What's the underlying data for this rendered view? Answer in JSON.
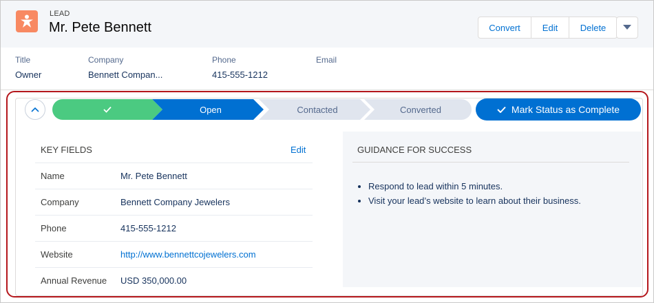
{
  "header": {
    "object_label": "LEAD",
    "title": "Mr. Pete Bennett",
    "icon": "lead-star-icon",
    "icon_color": "#f88962",
    "buttons": {
      "convert": "Convert",
      "edit": "Edit",
      "delete": "Delete",
      "more_icon": "chevron-down-icon"
    }
  },
  "highlights": [
    {
      "label": "Title",
      "value": "Owner"
    },
    {
      "label": "Company",
      "value": "Bennett Compan..."
    },
    {
      "label": "Phone",
      "value": "415-555-1212"
    },
    {
      "label": "Email",
      "value": ""
    }
  ],
  "path": {
    "toggle_icon": "chevron-up-icon",
    "stages": [
      {
        "label": "",
        "state": "complete",
        "icon": "check-icon"
      },
      {
        "label": "Open",
        "state": "current"
      },
      {
        "label": "Contacted",
        "state": "incomplete"
      },
      {
        "label": "Converted",
        "state": "incomplete"
      }
    ],
    "mark_complete_label": "Mark Status as Complete",
    "colors": {
      "complete": "#4bca81",
      "current": "#0070d2",
      "incomplete": "#e0e5ee"
    }
  },
  "key_fields": {
    "title": "KEY FIELDS",
    "edit_label": "Edit",
    "rows": [
      {
        "label": "Name",
        "value": "Mr. Pete Bennett"
      },
      {
        "label": "Company",
        "value": "Bennett Company Jewelers"
      },
      {
        "label": "Phone",
        "value": "415-555-1212"
      },
      {
        "label": "Website",
        "value": "http://www.bennettcojewelers.com"
      },
      {
        "label": "Annual Revenue",
        "value": "USD 350,000.00"
      }
    ]
  },
  "guidance": {
    "title": "GUIDANCE FOR SUCCESS",
    "items": [
      "Respond to lead within 5 minutes.",
      "Visit your lead’s website to learn about their business."
    ]
  },
  "highlight_outline_color": "#b4161b"
}
